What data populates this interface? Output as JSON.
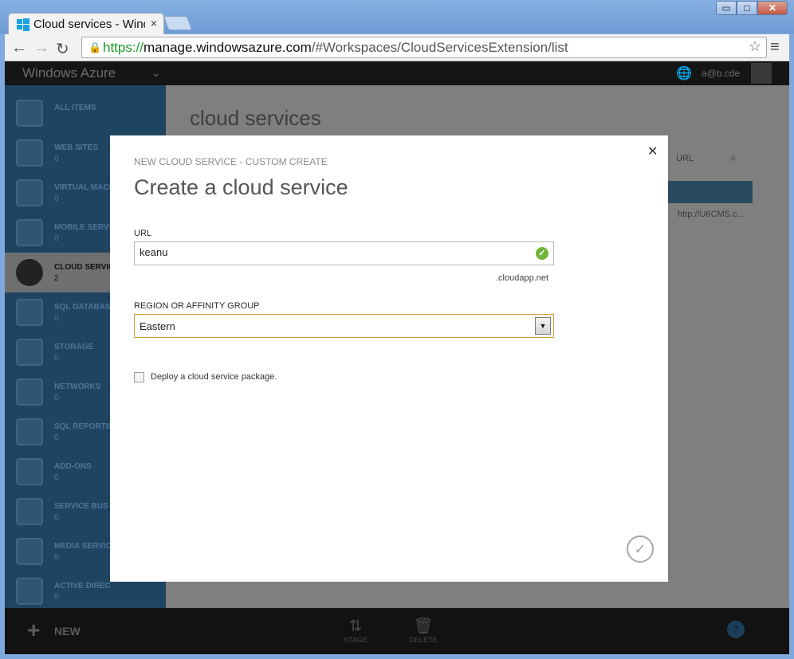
{
  "browser": {
    "tab_title": "Cloud services - Windows Azure",
    "tab_close": "×",
    "url_scheme": "https://",
    "url_host": "manage.windowsazure.com",
    "url_path": "/#Workspaces/CloudServicesExtension/list",
    "win_min": "▭",
    "win_max": "□",
    "win_close": "✕"
  },
  "azure": {
    "brand": "Windows Azure",
    "user": "a@b.cde",
    "page_title": "cloud services",
    "search_label": "URL",
    "row_url": "http://U6CMS.c..."
  },
  "sidebar": {
    "items": [
      {
        "label": "ALL ITEMS",
        "count": ""
      },
      {
        "label": "WEB SITES",
        "count": "0"
      },
      {
        "label": "VIRTUAL MACHINES",
        "count": "0"
      },
      {
        "label": "MOBILE SERVICES",
        "count": "0"
      },
      {
        "label": "CLOUD SERVICES",
        "count": "2"
      },
      {
        "label": "SQL DATABASES",
        "count": "0"
      },
      {
        "label": "STORAGE",
        "count": "0"
      },
      {
        "label": "NETWORKS",
        "count": "0"
      },
      {
        "label": "SQL REPORTING",
        "count": "0"
      },
      {
        "label": "ADD-ONS",
        "count": "0"
      },
      {
        "label": "SERVICE BUS",
        "count": "0"
      },
      {
        "label": "MEDIA SERVICES",
        "count": "0"
      },
      {
        "label": "ACTIVE DIRECTORY",
        "count": "0"
      }
    ]
  },
  "command_bar": {
    "new_label": "NEW",
    "cmd_1": "STAGE",
    "cmd_2": "DELETE"
  },
  "modal": {
    "subtitle": "NEW CLOUD SERVICE - CUSTOM CREATE",
    "title": "Create a cloud service",
    "url_label": "URL",
    "url_value": "keanu",
    "url_suffix": ".cloudapp.net",
    "region_label": "REGION OR AFFINITY GROUP",
    "region_value": "Eastern",
    "deploy_label": "Deploy a cloud service package.",
    "deploy_checked": false
  },
  "colors": {
    "accent_valid": "#6fb53a",
    "select_border": "#d29e3a",
    "sidebar_bg": "#1f4462"
  }
}
